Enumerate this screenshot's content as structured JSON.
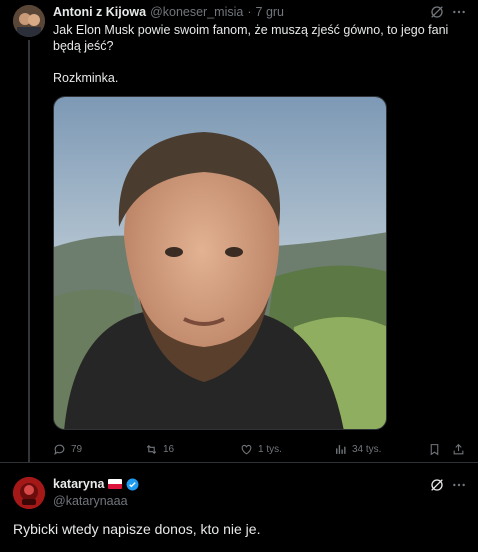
{
  "tweet1": {
    "author_name": "Antoni z Kijowa",
    "author_handle": "@koneser_misia",
    "separator": "·",
    "time": "7 gru",
    "text_line1": "Jak Elon Musk powie swoim fanom, że muszą zjeść gówno, to jego fani będą jeść?",
    "text_line2": "Rozkminka.",
    "stats": {
      "replies": "79",
      "retweets": "16",
      "likes": "1 tys.",
      "views": "34 tys."
    }
  },
  "tweet2": {
    "author_name": "kataryna",
    "author_handle": "@katarynaaa",
    "text": "Rybicki wtedy napisze donos, kto nie je."
  },
  "icons": {
    "grok": "grok-icon",
    "more": "more-icon",
    "reply": "reply-icon",
    "retweet": "retweet-icon",
    "like": "heart-icon",
    "views": "views-icon",
    "bookmark": "bookmark-icon",
    "share": "share-icon",
    "verified": "verified-badge-icon",
    "flag": "poland-flag-icon"
  },
  "colors": {
    "background": "#000000",
    "text": "#e7e9ea",
    "muted": "#71767b",
    "divider": "#2f3336",
    "verified": "#1d9bf0"
  }
}
